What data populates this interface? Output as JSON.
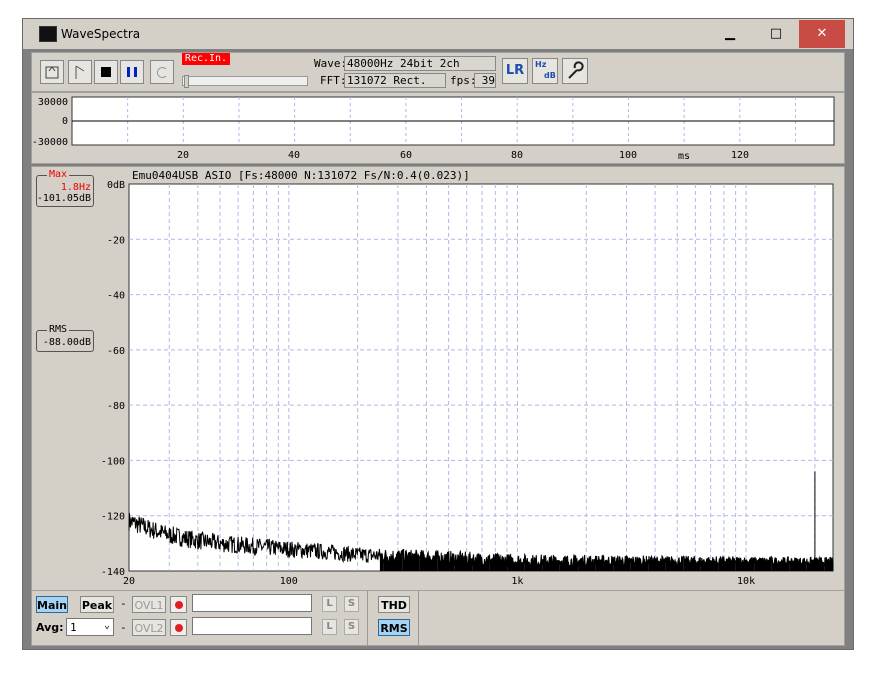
{
  "window": {
    "title": "WaveSpectra",
    "minimize": "▁",
    "maximize": "□",
    "close": "✕"
  },
  "toolbar": {
    "rec_in": "Rec.In.",
    "wave_label": "Wave:",
    "wave_value": "48000Hz 24bit 2ch",
    "fft_label": "FFT:",
    "fft_value": "131072 Rect.",
    "fps_label": "fps:",
    "fps_value": "39",
    "lr_label": "LR",
    "hz_label": "Hz",
    "db_label": "dB"
  },
  "wave": {
    "y_ticks": [
      "30000",
      "0",
      "-30000"
    ],
    "x_ticks": [
      "20",
      "40",
      "60",
      "80",
      "100",
      "120"
    ],
    "unit": "ms"
  },
  "spectrum": {
    "header": "Emu0404USB ASIO  [Fs:48000 N:131072 Fs/N:0.4(0.023)]",
    "max_title": "Max",
    "max_freq": "1.8Hz",
    "max_db": "-101.05dB",
    "rms_title": "RMS",
    "rms_db": "-88.00dB",
    "y_ticks": [
      "0dB",
      "-20",
      "-40",
      "-60",
      "-80",
      "-100",
      "-120",
      "-140"
    ],
    "x_ticks": [
      "20",
      "100",
      "1k",
      "10k"
    ]
  },
  "bottom": {
    "main": "Main",
    "peak": "Peak",
    "dash": "-",
    "ovl1": "OVL1",
    "ovl2": "OVL2",
    "avg_label": "Avg:",
    "avg_value": "1",
    "l": "L",
    "s": "S",
    "thd": "THD",
    "rms": "RMS"
  },
  "colors": {
    "rec_in_bg": "#ff0000",
    "active_btn": "#a7d3f1",
    "grid": "#b0b8e8",
    "close": "#c84b44"
  },
  "chart_data": {
    "type": "line",
    "xscale": "log",
    "xlim": [
      20,
      24000
    ],
    "ylim": [
      -140,
      0
    ],
    "ylabel": "dB",
    "x": [
      20,
      25,
      30,
      40,
      50,
      70,
      100,
      150,
      200,
      300,
      500,
      700,
      1000,
      2000,
      3000,
      5000,
      7000,
      10000,
      15000,
      20000,
      22000
    ],
    "values": [
      -123,
      -126,
      -128,
      -130,
      -131,
      -132,
      -133,
      -134,
      -135,
      -135.5,
      -136,
      -136.5,
      -137,
      -137,
      -137,
      -137,
      -137,
      -137,
      -137,
      -137,
      -137
    ],
    "peaks": [
      {
        "x": 20000,
        "y": -104
      }
    ]
  }
}
